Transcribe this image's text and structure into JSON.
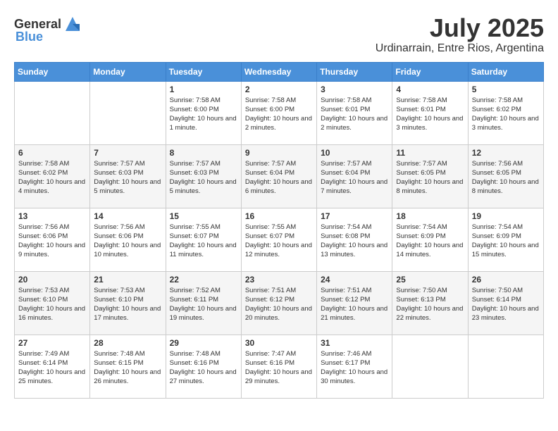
{
  "header": {
    "logo_general": "General",
    "logo_blue": "Blue",
    "month_title": "July 2025",
    "location": "Urdinarrain, Entre Rios, Argentina"
  },
  "calendar": {
    "days_of_week": [
      "Sunday",
      "Monday",
      "Tuesday",
      "Wednesday",
      "Thursday",
      "Friday",
      "Saturday"
    ],
    "weeks": [
      [
        {
          "day": "",
          "info": ""
        },
        {
          "day": "",
          "info": ""
        },
        {
          "day": "1",
          "info": "Sunrise: 7:58 AM\nSunset: 6:00 PM\nDaylight: 10 hours and 1 minute."
        },
        {
          "day": "2",
          "info": "Sunrise: 7:58 AM\nSunset: 6:00 PM\nDaylight: 10 hours and 2 minutes."
        },
        {
          "day": "3",
          "info": "Sunrise: 7:58 AM\nSunset: 6:01 PM\nDaylight: 10 hours and 2 minutes."
        },
        {
          "day": "4",
          "info": "Sunrise: 7:58 AM\nSunset: 6:01 PM\nDaylight: 10 hours and 3 minutes."
        },
        {
          "day": "5",
          "info": "Sunrise: 7:58 AM\nSunset: 6:02 PM\nDaylight: 10 hours and 3 minutes."
        }
      ],
      [
        {
          "day": "6",
          "info": "Sunrise: 7:58 AM\nSunset: 6:02 PM\nDaylight: 10 hours and 4 minutes."
        },
        {
          "day": "7",
          "info": "Sunrise: 7:57 AM\nSunset: 6:03 PM\nDaylight: 10 hours and 5 minutes."
        },
        {
          "day": "8",
          "info": "Sunrise: 7:57 AM\nSunset: 6:03 PM\nDaylight: 10 hours and 5 minutes."
        },
        {
          "day": "9",
          "info": "Sunrise: 7:57 AM\nSunset: 6:04 PM\nDaylight: 10 hours and 6 minutes."
        },
        {
          "day": "10",
          "info": "Sunrise: 7:57 AM\nSunset: 6:04 PM\nDaylight: 10 hours and 7 minutes."
        },
        {
          "day": "11",
          "info": "Sunrise: 7:57 AM\nSunset: 6:05 PM\nDaylight: 10 hours and 8 minutes."
        },
        {
          "day": "12",
          "info": "Sunrise: 7:56 AM\nSunset: 6:05 PM\nDaylight: 10 hours and 8 minutes."
        }
      ],
      [
        {
          "day": "13",
          "info": "Sunrise: 7:56 AM\nSunset: 6:06 PM\nDaylight: 10 hours and 9 minutes."
        },
        {
          "day": "14",
          "info": "Sunrise: 7:56 AM\nSunset: 6:06 PM\nDaylight: 10 hours and 10 minutes."
        },
        {
          "day": "15",
          "info": "Sunrise: 7:55 AM\nSunset: 6:07 PM\nDaylight: 10 hours and 11 minutes."
        },
        {
          "day": "16",
          "info": "Sunrise: 7:55 AM\nSunset: 6:07 PM\nDaylight: 10 hours and 12 minutes."
        },
        {
          "day": "17",
          "info": "Sunrise: 7:54 AM\nSunset: 6:08 PM\nDaylight: 10 hours and 13 minutes."
        },
        {
          "day": "18",
          "info": "Sunrise: 7:54 AM\nSunset: 6:09 PM\nDaylight: 10 hours and 14 minutes."
        },
        {
          "day": "19",
          "info": "Sunrise: 7:54 AM\nSunset: 6:09 PM\nDaylight: 10 hours and 15 minutes."
        }
      ],
      [
        {
          "day": "20",
          "info": "Sunrise: 7:53 AM\nSunset: 6:10 PM\nDaylight: 10 hours and 16 minutes."
        },
        {
          "day": "21",
          "info": "Sunrise: 7:53 AM\nSunset: 6:10 PM\nDaylight: 10 hours and 17 minutes."
        },
        {
          "day": "22",
          "info": "Sunrise: 7:52 AM\nSunset: 6:11 PM\nDaylight: 10 hours and 19 minutes."
        },
        {
          "day": "23",
          "info": "Sunrise: 7:51 AM\nSunset: 6:12 PM\nDaylight: 10 hours and 20 minutes."
        },
        {
          "day": "24",
          "info": "Sunrise: 7:51 AM\nSunset: 6:12 PM\nDaylight: 10 hours and 21 minutes."
        },
        {
          "day": "25",
          "info": "Sunrise: 7:50 AM\nSunset: 6:13 PM\nDaylight: 10 hours and 22 minutes."
        },
        {
          "day": "26",
          "info": "Sunrise: 7:50 AM\nSunset: 6:14 PM\nDaylight: 10 hours and 23 minutes."
        }
      ],
      [
        {
          "day": "27",
          "info": "Sunrise: 7:49 AM\nSunset: 6:14 PM\nDaylight: 10 hours and 25 minutes."
        },
        {
          "day": "28",
          "info": "Sunrise: 7:48 AM\nSunset: 6:15 PM\nDaylight: 10 hours and 26 minutes."
        },
        {
          "day": "29",
          "info": "Sunrise: 7:48 AM\nSunset: 6:16 PM\nDaylight: 10 hours and 27 minutes."
        },
        {
          "day": "30",
          "info": "Sunrise: 7:47 AM\nSunset: 6:16 PM\nDaylight: 10 hours and 29 minutes."
        },
        {
          "day": "31",
          "info": "Sunrise: 7:46 AM\nSunset: 6:17 PM\nDaylight: 10 hours and 30 minutes."
        },
        {
          "day": "",
          "info": ""
        },
        {
          "day": "",
          "info": ""
        }
      ]
    ]
  }
}
